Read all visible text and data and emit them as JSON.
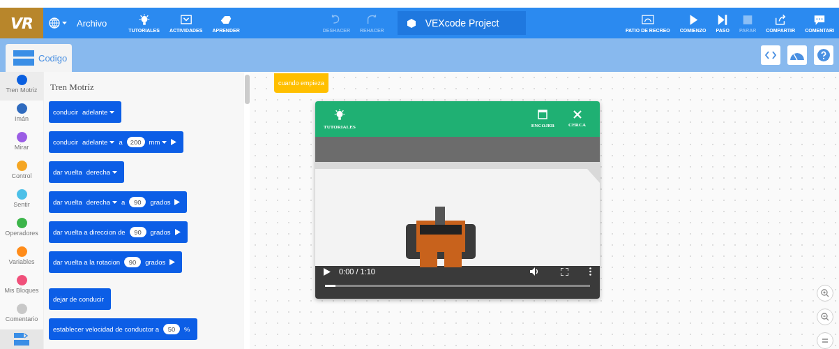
{
  "header": {
    "logo": "VR",
    "menu": "Archivo",
    "tools": [
      {
        "kind": "bulb",
        "label": "TUTORIALES",
        "disabled": false
      },
      {
        "kind": "activity",
        "label": "ACTIVIDADES",
        "disabled": false
      },
      {
        "kind": "learn",
        "label": "APRENDER",
        "disabled": false
      }
    ],
    "history": [
      {
        "kind": "undo",
        "label": "DESHACER",
        "disabled": true
      },
      {
        "kind": "redo",
        "label": "REHACER",
        "disabled": true
      }
    ],
    "project_name": "VEXcode Project",
    "actions": [
      {
        "kind": "playground",
        "label": "PATIO DE RECREO",
        "disabled": false
      },
      {
        "kind": "play",
        "label": "COMIENZO",
        "disabled": false
      },
      {
        "kind": "step",
        "label": "PASO",
        "disabled": false
      },
      {
        "kind": "stop",
        "label": "PARAR",
        "disabled": true
      },
      {
        "kind": "share",
        "label": "COMPARTIR",
        "disabled": false
      },
      {
        "kind": "comment",
        "label": "COMENTARI",
        "disabled": false
      }
    ]
  },
  "tabs": [
    {
      "label": "Codigo",
      "selected": true
    }
  ],
  "categories": [
    {
      "name": "Tren Motriz",
      "color": "#0a5fe0",
      "selected": true
    },
    {
      "name": "Imán",
      "color": "#2f6bbf",
      "selected": false
    },
    {
      "name": "Mirar",
      "color": "#9b5de5",
      "selected": false
    },
    {
      "name": "Control",
      "color": "#f5a623",
      "selected": false
    },
    {
      "name": "Sentir",
      "color": "#4cc0e8",
      "selected": false
    },
    {
      "name": "Operadores",
      "color": "#3cb54a",
      "selected": false
    },
    {
      "name": "Variables",
      "color": "#ff8c1a",
      "selected": false
    },
    {
      "name": "Mis Bloques",
      "color": "#f0507a",
      "selected": false
    },
    {
      "name": "Comentario",
      "color": "#c8c8c8",
      "selected": false
    }
  ],
  "palette": {
    "title": "Tren Motríz",
    "blocks": [
      {
        "parts": [
          {
            "kind": "label",
            "text": "conducir"
          },
          {
            "kind": "dropdown",
            "text": "adelante"
          }
        ]
      },
      {
        "parts": [
          {
            "kind": "label",
            "text": "conducir"
          },
          {
            "kind": "dropdown",
            "text": "adelante"
          },
          {
            "kind": "label",
            "text": "a"
          },
          {
            "kind": "number",
            "text": "200"
          },
          {
            "kind": "dropdown",
            "text": "mm"
          },
          {
            "kind": "run"
          }
        ]
      },
      {
        "parts": [
          {
            "kind": "label",
            "text": "dar vuelta"
          },
          {
            "kind": "dropdown",
            "text": "derecha"
          }
        ]
      },
      {
        "parts": [
          {
            "kind": "label",
            "text": "dar vuelta"
          },
          {
            "kind": "dropdown",
            "text": "derecha"
          },
          {
            "kind": "label",
            "text": "a"
          },
          {
            "kind": "number",
            "text": "90"
          },
          {
            "kind": "label",
            "text": "grados"
          },
          {
            "kind": "run"
          }
        ]
      },
      {
        "parts": [
          {
            "kind": "label",
            "text": "dar vuelta a direccion de"
          },
          {
            "kind": "number",
            "text": "90"
          },
          {
            "kind": "label",
            "text": "grados"
          },
          {
            "kind": "run"
          }
        ]
      },
      {
        "parts": [
          {
            "kind": "label",
            "text": "dar vuelta a la rotacion"
          },
          {
            "kind": "number",
            "text": "90"
          },
          {
            "kind": "label",
            "text": "grados"
          },
          {
            "kind": "run"
          }
        ]
      },
      {
        "parts": [
          {
            "kind": "label",
            "text": "dejar de conducir"
          }
        ]
      },
      {
        "parts": [
          {
            "kind": "label",
            "text": "establecer velocidad de conductor a"
          },
          {
            "kind": "number",
            "text": "50"
          },
          {
            "kind": "label",
            "text": "%"
          }
        ]
      }
    ]
  },
  "workspace": {
    "hat_block": "cuando empieza",
    "video_panel": {
      "tutorials": "TUTORIALES",
      "shrink": "ENCOJER",
      "close": "CERCA",
      "video": {
        "kind": "picture",
        "time": "0:00 / 1:10",
        "level": 0.04
      }
    }
  }
}
